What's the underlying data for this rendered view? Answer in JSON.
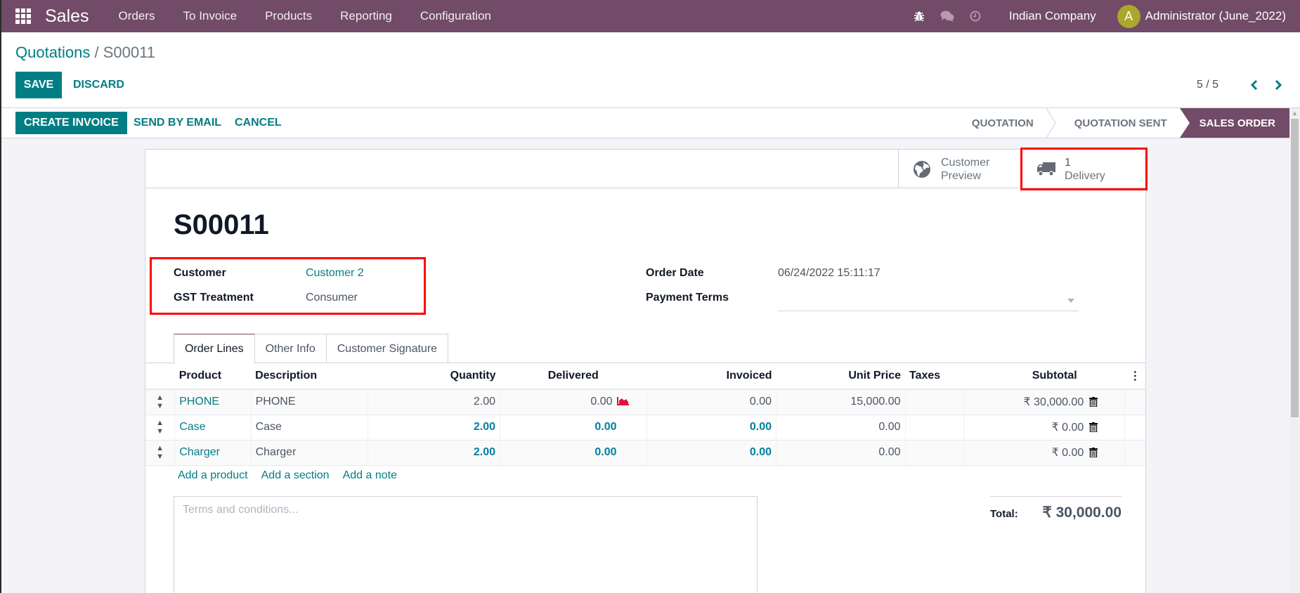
{
  "navbar": {
    "app_name": "Sales",
    "menu": [
      "Orders",
      "To Invoice",
      "Products",
      "Reporting",
      "Configuration"
    ],
    "icons": [
      "bug-icon",
      "chat-icon",
      "clock-icon"
    ],
    "company": "Indian Company",
    "avatar_initial": "A",
    "user": "Administrator (June_2022)"
  },
  "breadcrumb": {
    "parent": "Quotations",
    "separator": " / ",
    "current": "S00011"
  },
  "toolbar": {
    "save_label": "SAVE",
    "discard_label": "DISCARD",
    "pager_value": "5 / 5"
  },
  "statusbar": {
    "actions": {
      "create_invoice": "CREATE INVOICE",
      "send_by_email": "SEND BY EMAIL",
      "cancel": "CANCEL"
    },
    "stages": [
      {
        "label": "QUOTATION",
        "active": false
      },
      {
        "label": "QUOTATION SENT",
        "active": false
      },
      {
        "label": "SALES ORDER",
        "active": true
      }
    ]
  },
  "button_box": {
    "customer_preview": {
      "line1": "Customer",
      "line2": "Preview"
    },
    "delivery": {
      "count": "1",
      "label": "Delivery"
    }
  },
  "form": {
    "title": "S00011",
    "customer_label": "Customer",
    "customer_value": "Customer 2",
    "gst_label": "GST Treatment",
    "gst_value": "Consumer",
    "order_date_label": "Order Date",
    "order_date_value": "06/24/2022 15:11:17",
    "payment_terms_label": "Payment Terms",
    "payment_terms_value": ""
  },
  "tabs": [
    {
      "label": "Order Lines",
      "active": true
    },
    {
      "label": "Other Info",
      "active": false
    },
    {
      "label": "Customer Signature",
      "active": false
    }
  ],
  "order_lines": {
    "columns": [
      "Product",
      "Description",
      "Quantity",
      "Delivered",
      "Invoiced",
      "Unit Price",
      "Taxes",
      "Subtotal"
    ],
    "rows": [
      {
        "product": "PHONE",
        "description": "PHONE",
        "quantity": "2.00",
        "delivered": "0.00",
        "invoiced": "0.00",
        "unit_price": "15,000.00",
        "taxes": "",
        "subtotal": "₹ 30,000.00"
      },
      {
        "product": "Case",
        "description": "Case",
        "quantity": "2.00",
        "delivered": "0.00",
        "invoiced": "0.00",
        "unit_price": "0.00",
        "taxes": "",
        "subtotal": "₹ 0.00"
      },
      {
        "product": "Charger",
        "description": "Charger",
        "quantity": "2.00",
        "delivered": "0.00",
        "invoiced": "0.00",
        "unit_price": "0.00",
        "taxes": "",
        "subtotal": "₹ 0.00"
      }
    ],
    "add_product": "Add a product",
    "add_section": "Add a section",
    "add_note": "Add a note"
  },
  "terms": {
    "placeholder": "Terms and conditions...",
    "value": ""
  },
  "totals": {
    "label": "Total:",
    "value": "₹ 30,000.00"
  },
  "colors": {
    "brand": "#714b67",
    "primary": "#017e84",
    "highlight": "#ff0000",
    "forecast": "#dc143c"
  }
}
